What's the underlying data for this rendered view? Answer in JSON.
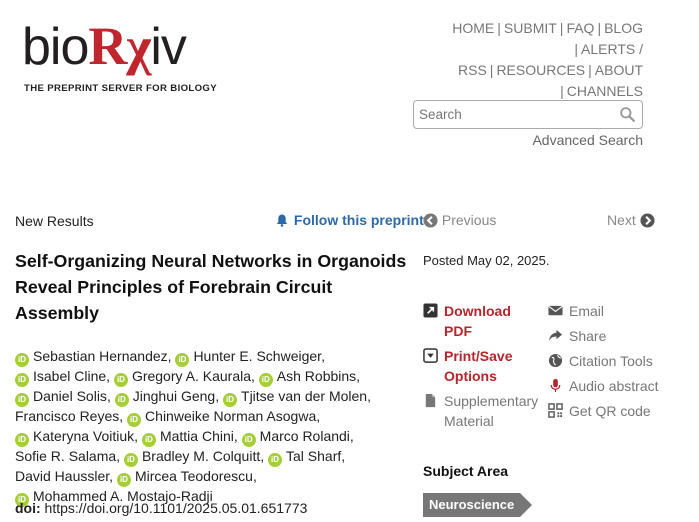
{
  "logo": {
    "bio": "bio",
    "rx": "Rχ",
    "iv": "iv",
    "tagline": "THE PREPRINT SERVER FOR BIOLOGY"
  },
  "nav": {
    "home": "HOME",
    "submit": "SUBMIT",
    "faq": "FAQ",
    "blog": "BLOG",
    "alerts": "ALERTS / RSS",
    "resources": "RESOURCES",
    "about": "ABOUT",
    "channels": "CHANNELS",
    "separator": "|"
  },
  "search": {
    "placeholder": "Search",
    "advanced": "Advanced Search"
  },
  "article": {
    "section": "New Results",
    "follow": "Follow this preprint",
    "previous": "Previous",
    "next": "Next",
    "title": "Self-Organizing Neural Networks in Organoids Reveal Principles of Forebrain Circuit Assembly",
    "authors": [
      "Sebastian Hernandez",
      "Hunter E. Schweiger",
      "Isabel Cline",
      "Gregory A. Kaurala",
      "Ash Robbins",
      "Daniel Solis",
      "Jinghui Geng",
      "Tjitse van der Molen",
      "Francisco Reyes",
      "Chinweike Norman Asogwa",
      "Kateryna Voitiuk",
      "Mattia Chini",
      "Marco Rolandi",
      "Sofie R. Salama",
      "Bradley M. Colquitt",
      "Tal Sharf",
      "David Haussler",
      "Mircea Teodorescu",
      "Mohammed A. Mostajo-Radji"
    ],
    "author_separator": ",",
    "orcid_label": "iD",
    "doi_label": "doi:",
    "doi": "https://doi.org/10.1101/2025.05.01.651773",
    "posted": "Posted May 02, 2025."
  },
  "actions": {
    "download_line1": "Download",
    "download_line2": "PDF",
    "print_line1": "Print/Save",
    "print_line2": "Options",
    "supp_line1": "Supplementary",
    "supp_line2": "Material",
    "email": "Email",
    "share": "Share",
    "citation": "Citation Tools",
    "audio": "Audio abstract",
    "qr": "Get QR code"
  },
  "subject": {
    "heading": "Subject Area",
    "tag": "Neuroscience"
  },
  "colors": {
    "brand_red": "#c0262d",
    "link_blue": "#2c69a5",
    "orcid_green": "#a6ce39",
    "tag_grey": "#777777"
  }
}
